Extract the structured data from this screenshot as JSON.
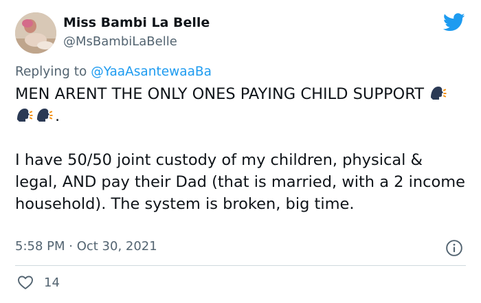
{
  "tweet": {
    "display_name": "Miss Bambi La Belle",
    "handle": "@MsBambiLaBelle",
    "replying_prefix": "Replying to ",
    "replying_to": "@YaaAsantewaaBa",
    "text_line1": "MEN ARENT THE ONLY ONES PAYING CHILD SUPPORT",
    "emoji_trailing": ".",
    "paragraph2": "I have 50/50 joint custody of my children, physical & legal, AND pay their Dad (that is married, with a 2 income household). The system is broken, big time.",
    "timestamp": "5:58 PM · Oct 30, 2021",
    "like_count": "14"
  },
  "icons": {
    "logo": "twitter-bird-icon",
    "emoji": "speaking-head-emoji",
    "info": "info-icon",
    "like": "heart-icon"
  },
  "colors": {
    "twitter_blue": "#1d9bf0",
    "text_primary": "#0f1419",
    "text_secondary": "#536471",
    "divider": "#cfd9de"
  }
}
